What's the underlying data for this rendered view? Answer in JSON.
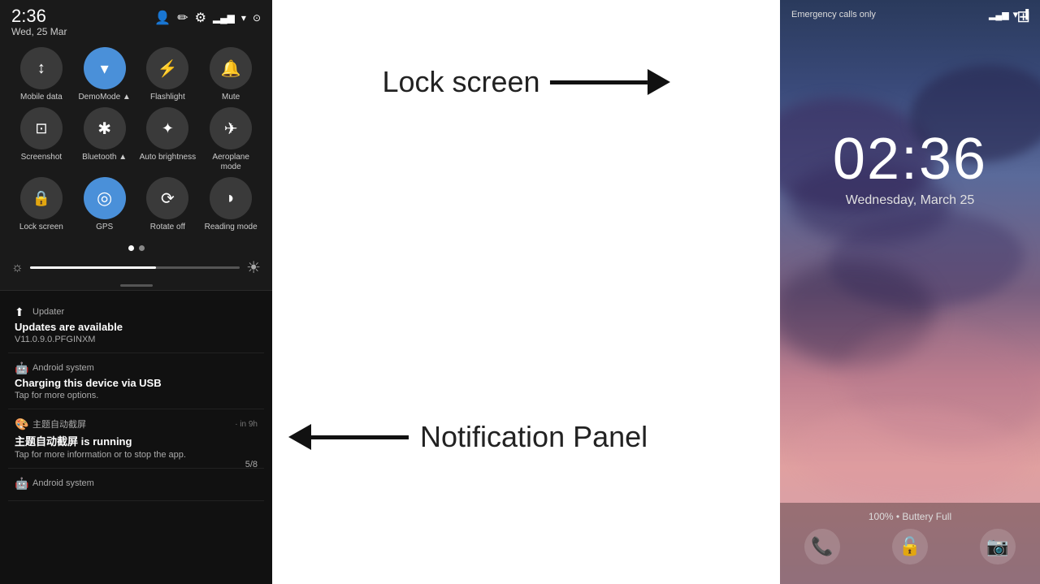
{
  "left_panel": {
    "status_bar": {
      "time": "2:36",
      "date": "Wed, 25 Mar",
      "icons": [
        "⊕",
        "✏",
        "⚙"
      ]
    },
    "quick_settings": {
      "rows": [
        [
          {
            "label": "Mobile data",
            "icon": "↕",
            "active": false
          },
          {
            "label": "DemoMode ▲",
            "icon": "▾",
            "active": true
          },
          {
            "label": "Flashlight",
            "icon": "⚡",
            "active": false
          },
          {
            "label": "Mute",
            "icon": "🔔",
            "active": false
          }
        ],
        [
          {
            "label": "Screenshot",
            "icon": "📷",
            "active": false
          },
          {
            "label": "Bluetooth ▲",
            "icon": "✱",
            "active": false
          },
          {
            "label": "Auto brightness",
            "icon": "☀",
            "active": false
          },
          {
            "label": "Aeroplane mode",
            "icon": "✈",
            "active": false
          }
        ],
        [
          {
            "label": "Lock screen",
            "icon": "🔒",
            "active": false
          },
          {
            "label": "GPS",
            "icon": "◎",
            "active": true
          },
          {
            "label": "Rotate off",
            "icon": "⟳",
            "active": false
          },
          {
            "label": "Reading mode",
            "icon": "◗",
            "active": false
          }
        ]
      ]
    },
    "page_dots": [
      true,
      false
    ],
    "brightness": {
      "value": 60
    },
    "notifications": [
      {
        "app_icon": "⬆",
        "app_name": "Updater",
        "time": "",
        "title": "Updates are available",
        "body": "V11.0.9.0.PFGINXM"
      },
      {
        "app_icon": "🤖",
        "app_name": "Android system",
        "time": "",
        "title": "Charging this device via USB",
        "body": "Tap for more options."
      },
      {
        "app_icon": "🎨",
        "app_name": "主题自动截屏",
        "time": "· in 9h",
        "title": "主题自动截屏 is running",
        "body": "Tap for more information or to stop the app."
      },
      {
        "app_icon": "🤖",
        "app_name": "Android system",
        "time": "",
        "title": "",
        "body": ""
      }
    ],
    "counter": "5/8"
  },
  "middle_panel": {
    "lock_screen_label": "Lock screen",
    "notification_panel_label": "Notification Panel"
  },
  "right_panel": {
    "emergency_text": "Emergency calls only",
    "time": "02:36",
    "date": "Wednesday, March 25",
    "battery_text": "100% • Buttery Full"
  }
}
